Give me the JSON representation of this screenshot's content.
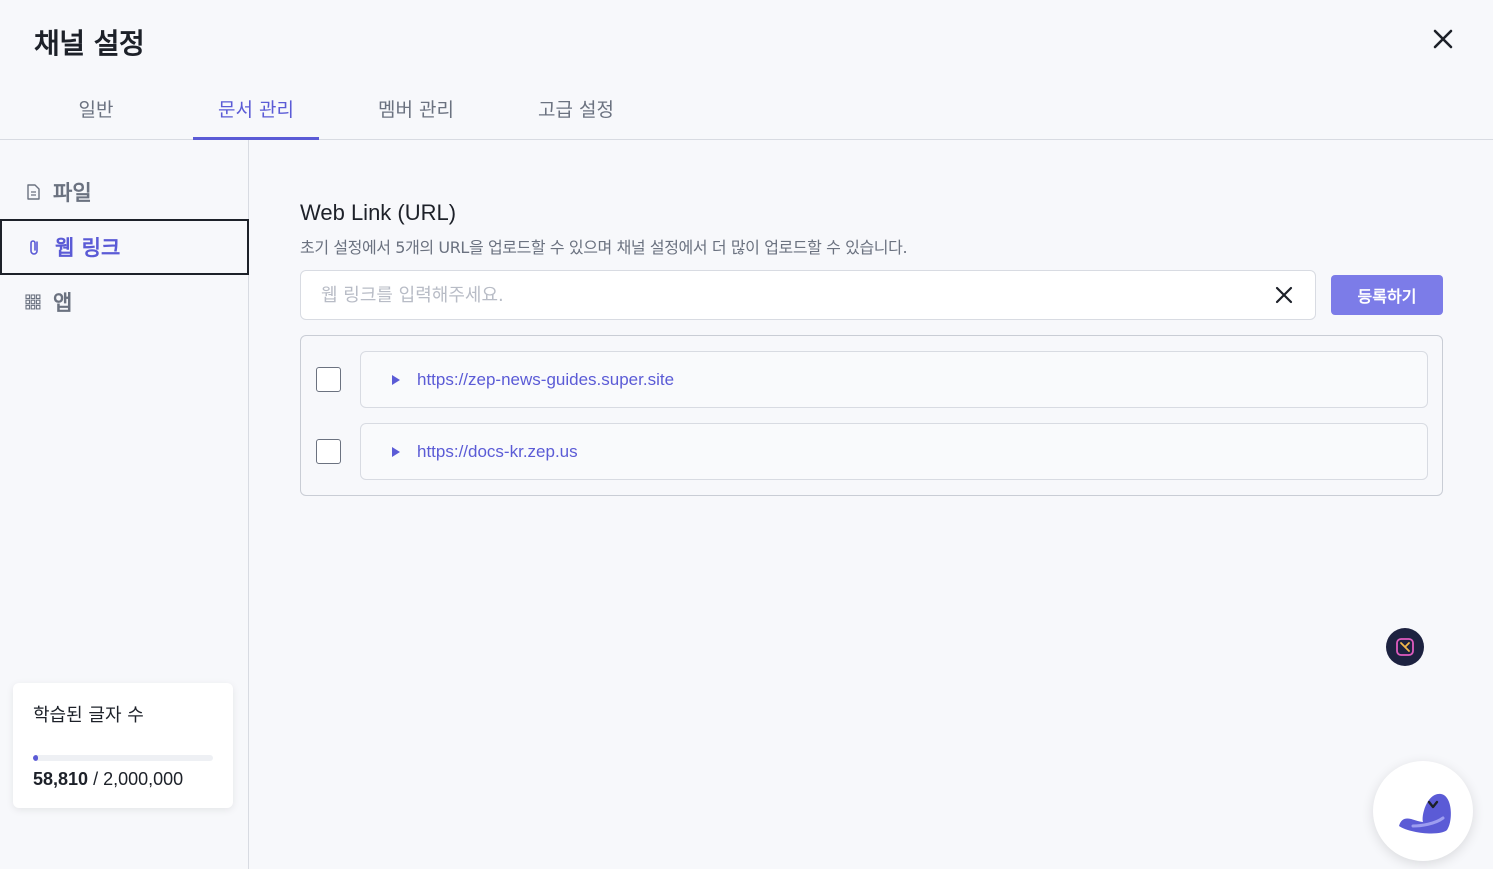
{
  "header": {
    "title": "채널 설정"
  },
  "tabs": [
    {
      "label": "일반",
      "active": false
    },
    {
      "label": "문서 관리",
      "active": true
    },
    {
      "label": "멤버 관리",
      "active": false
    },
    {
      "label": "고급 설정",
      "active": false
    }
  ],
  "sidebar": {
    "items": [
      {
        "label": "파일",
        "icon": "file-icon",
        "active": false
      },
      {
        "label": "웹 링크",
        "icon": "paperclip-icon",
        "active": true
      },
      {
        "label": "앱",
        "icon": "grid-icon",
        "active": false
      }
    ],
    "usage": {
      "title": "학습된 글자 수",
      "used": "58,810",
      "separator": " / ",
      "total": "2,000,000",
      "fraction": 0.0294
    }
  },
  "main": {
    "section_title": "Web Link (URL)",
    "section_desc": "초기 설정에서 5개의 URL을 업로드할 수 있으며 채널 설정에서 더 많이 업로드할 수 있습니다.",
    "input": {
      "placeholder": "웹 링크를 입력해주세요.",
      "value": ""
    },
    "register_label": "등록하기",
    "links": [
      {
        "url": "https://zep-news-guides.super.site",
        "checked": false
      },
      {
        "url": "https://docs-kr.zep.us",
        "checked": false
      }
    ]
  },
  "colors": {
    "accent": "#5b5bd6",
    "button": "#7c7ce8",
    "background": "#f7f8fb"
  }
}
